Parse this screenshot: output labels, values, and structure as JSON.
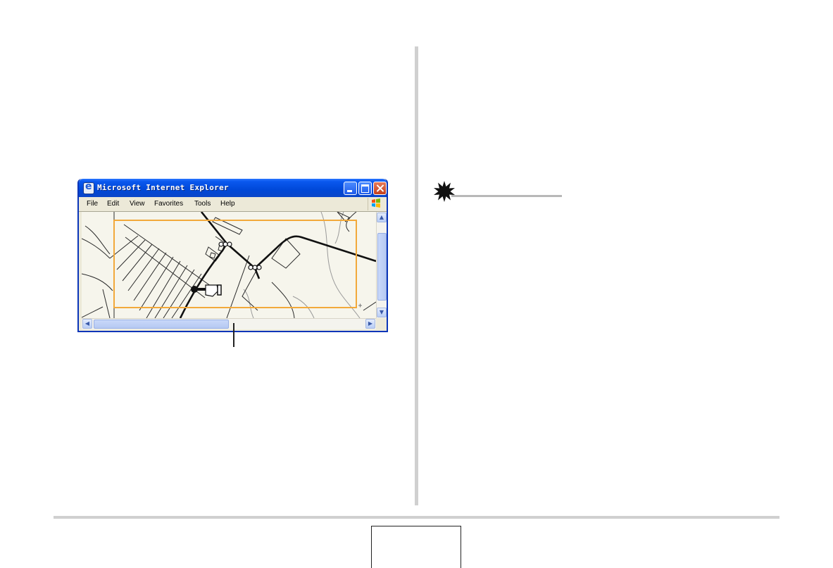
{
  "window": {
    "title": "Microsoft Internet Explorer",
    "menu": [
      "File",
      "Edit",
      "View",
      "Favorites",
      "Tools",
      "Help"
    ]
  },
  "colors": {
    "titlebar": "#0a58ee",
    "selection_frame": "#f2a93b",
    "divider": "#d0d0d0"
  },
  "icons": {
    "title_icon": "ie-icon",
    "note_marker": "burst-icon"
  }
}
